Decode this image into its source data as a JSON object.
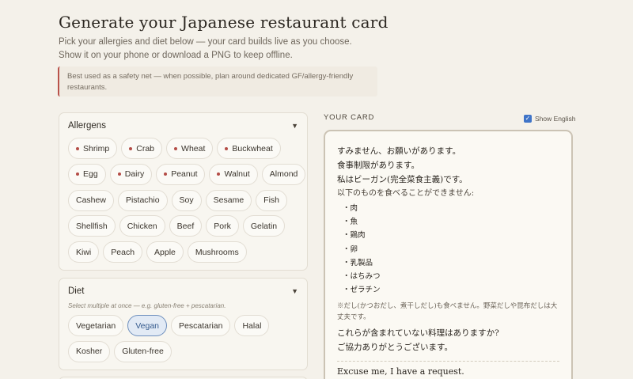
{
  "header": {
    "title": "Generate your Japanese restaurant card",
    "subtitle": "Pick your allergies and diet below — your card builds live as you choose. Show it on your phone or download a PNG to keep offline.",
    "notice": "Best used as a safety net — when possible, plan around dedicated GF/allergy-friendly restaurants."
  },
  "allergens": {
    "title": "Allergens",
    "caret": "▼",
    "rows": [
      [
        {
          "label": "Shrimp",
          "dot": true
        },
        {
          "label": "Crab",
          "dot": true
        },
        {
          "label": "Wheat",
          "dot": true
        },
        {
          "label": "Buckwheat",
          "dot": true
        }
      ],
      [
        {
          "label": "Egg",
          "dot": true
        },
        {
          "label": "Dairy",
          "dot": true
        },
        {
          "label": "Peanut",
          "dot": true
        },
        {
          "label": "Walnut",
          "dot": true
        },
        {
          "label": "Almond",
          "dot": false
        }
      ],
      [
        {
          "label": "Cashew",
          "dot": false
        },
        {
          "label": "Pistachio",
          "dot": false
        },
        {
          "label": "Soy",
          "dot": false
        },
        {
          "label": "Sesame",
          "dot": false
        },
        {
          "label": "Fish",
          "dot": false
        }
      ],
      [
        {
          "label": "Shellfish",
          "dot": false
        },
        {
          "label": "Chicken",
          "dot": false
        },
        {
          "label": "Beef",
          "dot": false
        },
        {
          "label": "Pork",
          "dot": false
        },
        {
          "label": "Gelatin",
          "dot": false
        }
      ],
      [
        {
          "label": "Kiwi",
          "dot": false
        },
        {
          "label": "Peach",
          "dot": false
        },
        {
          "label": "Apple",
          "dot": false
        },
        {
          "label": "Mushrooms",
          "dot": false
        }
      ]
    ]
  },
  "diet": {
    "title": "Diet",
    "caret": "▼",
    "hint": "Select multiple at once — e.g. gluten-free + pescatarian.",
    "rows": [
      [
        {
          "label": "Vegetarian",
          "selected": false
        },
        {
          "label": "Vegan",
          "selected": true
        },
        {
          "label": "Pescatarian",
          "selected": false
        },
        {
          "label": "Halal",
          "selected": false
        }
      ],
      [
        {
          "label": "Kosher",
          "selected": false
        },
        {
          "label": "Gluten-free",
          "selected": false
        }
      ]
    ]
  },
  "card": {
    "section_label": "YOUR CARD",
    "show_english_label": "Show English",
    "show_english_checked": true,
    "jp_greeting": "すみません、お願いがあります。",
    "jp_restriction": "食事制限があります。",
    "jp_diet": "私はビーガン(完全菜食主義)です。",
    "jp_cannot_eat": "以下のものを食べることができません:",
    "jp_items": [
      "・肉",
      "・魚",
      "・鶏肉",
      "・卵",
      "・乳製品",
      "・はちみつ",
      "・ゼラチン"
    ],
    "jp_note": "※だし(かつおだし、煮干しだし)も食べません。野菜だしや昆布だしは大丈夫です。",
    "jp_question": "これらが含まれていない料理はありますか?",
    "jp_thanks": "ご協力ありがとうございます。",
    "en_greeting": "Excuse me, I have a request."
  },
  "colors": {
    "background": "#f4f1ea",
    "allergen_dot": "#b44c46",
    "selected_chip_bg": "#e2eaf5",
    "selected_chip_border": "#6e8fbd",
    "notice_border": "#b9524a",
    "checkbox": "#3f74c8"
  }
}
